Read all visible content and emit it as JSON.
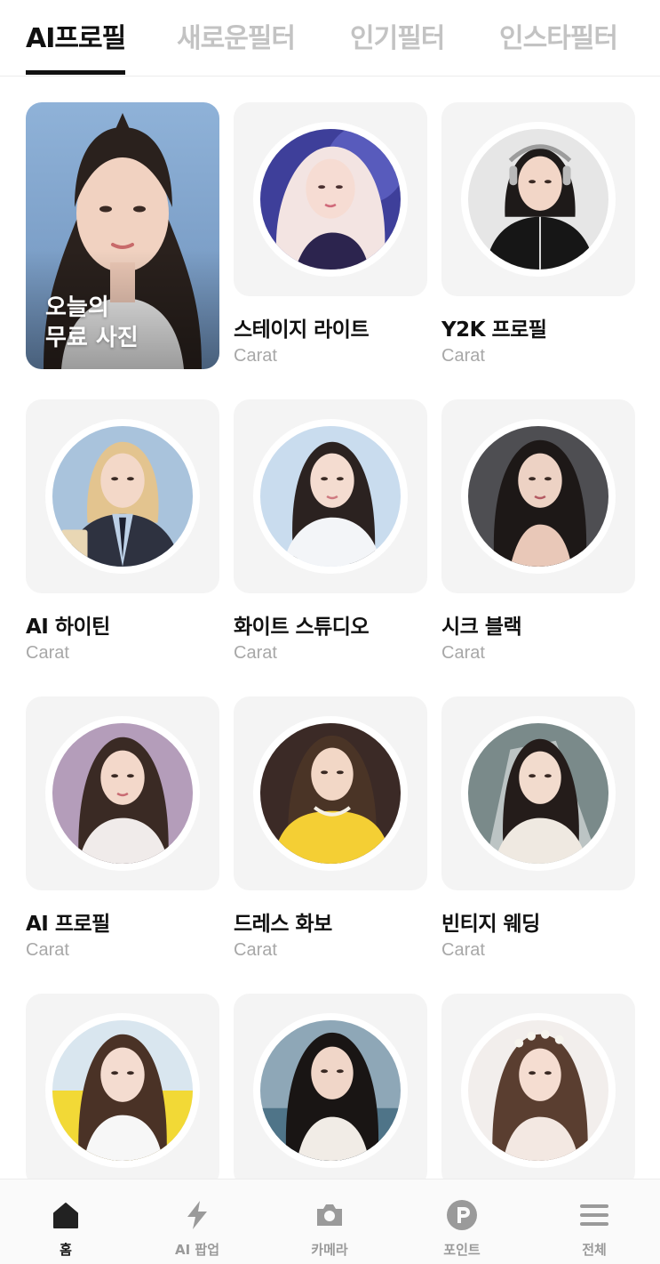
{
  "tabs": [
    {
      "label": "AI프로필",
      "active": true
    },
    {
      "label": "새로운필터",
      "active": false
    },
    {
      "label": "인기필터",
      "active": false
    },
    {
      "label": "인스타필터",
      "active": false
    }
  ],
  "featured": {
    "label": "오늘의\n무료 사진"
  },
  "filters": [
    {
      "title": "스테이지 라이트",
      "sub": "Carat"
    },
    {
      "title": "Y2K 프로필",
      "sub": "Carat"
    },
    {
      "title": "AI 하이틴",
      "sub": "Carat"
    },
    {
      "title": "화이트 스튜디오",
      "sub": "Carat"
    },
    {
      "title": "시크 블랙",
      "sub": "Carat"
    },
    {
      "title": "AI 프로필",
      "sub": "Carat"
    },
    {
      "title": "드레스 화보",
      "sub": "Carat"
    },
    {
      "title": "빈티지 웨딩",
      "sub": "Carat"
    },
    {
      "title": "",
      "sub": ""
    },
    {
      "title": "",
      "sub": ""
    },
    {
      "title": "",
      "sub": ""
    }
  ],
  "bottom_nav": [
    {
      "label": "홈",
      "icon": "home-icon",
      "active": true
    },
    {
      "label": "AI 팝업",
      "icon": "lightning-icon",
      "active": false
    },
    {
      "label": "카메라",
      "icon": "camera-icon",
      "active": false
    },
    {
      "label": "포인트",
      "icon": "point-icon",
      "active": false
    },
    {
      "label": "전체",
      "icon": "menu-icon",
      "active": false
    }
  ],
  "colors": {
    "accent": "#111111",
    "inactive": "#c3c3c3",
    "card_bg": "#f4f4f4",
    "sub_text": "#a8a8a8"
  }
}
